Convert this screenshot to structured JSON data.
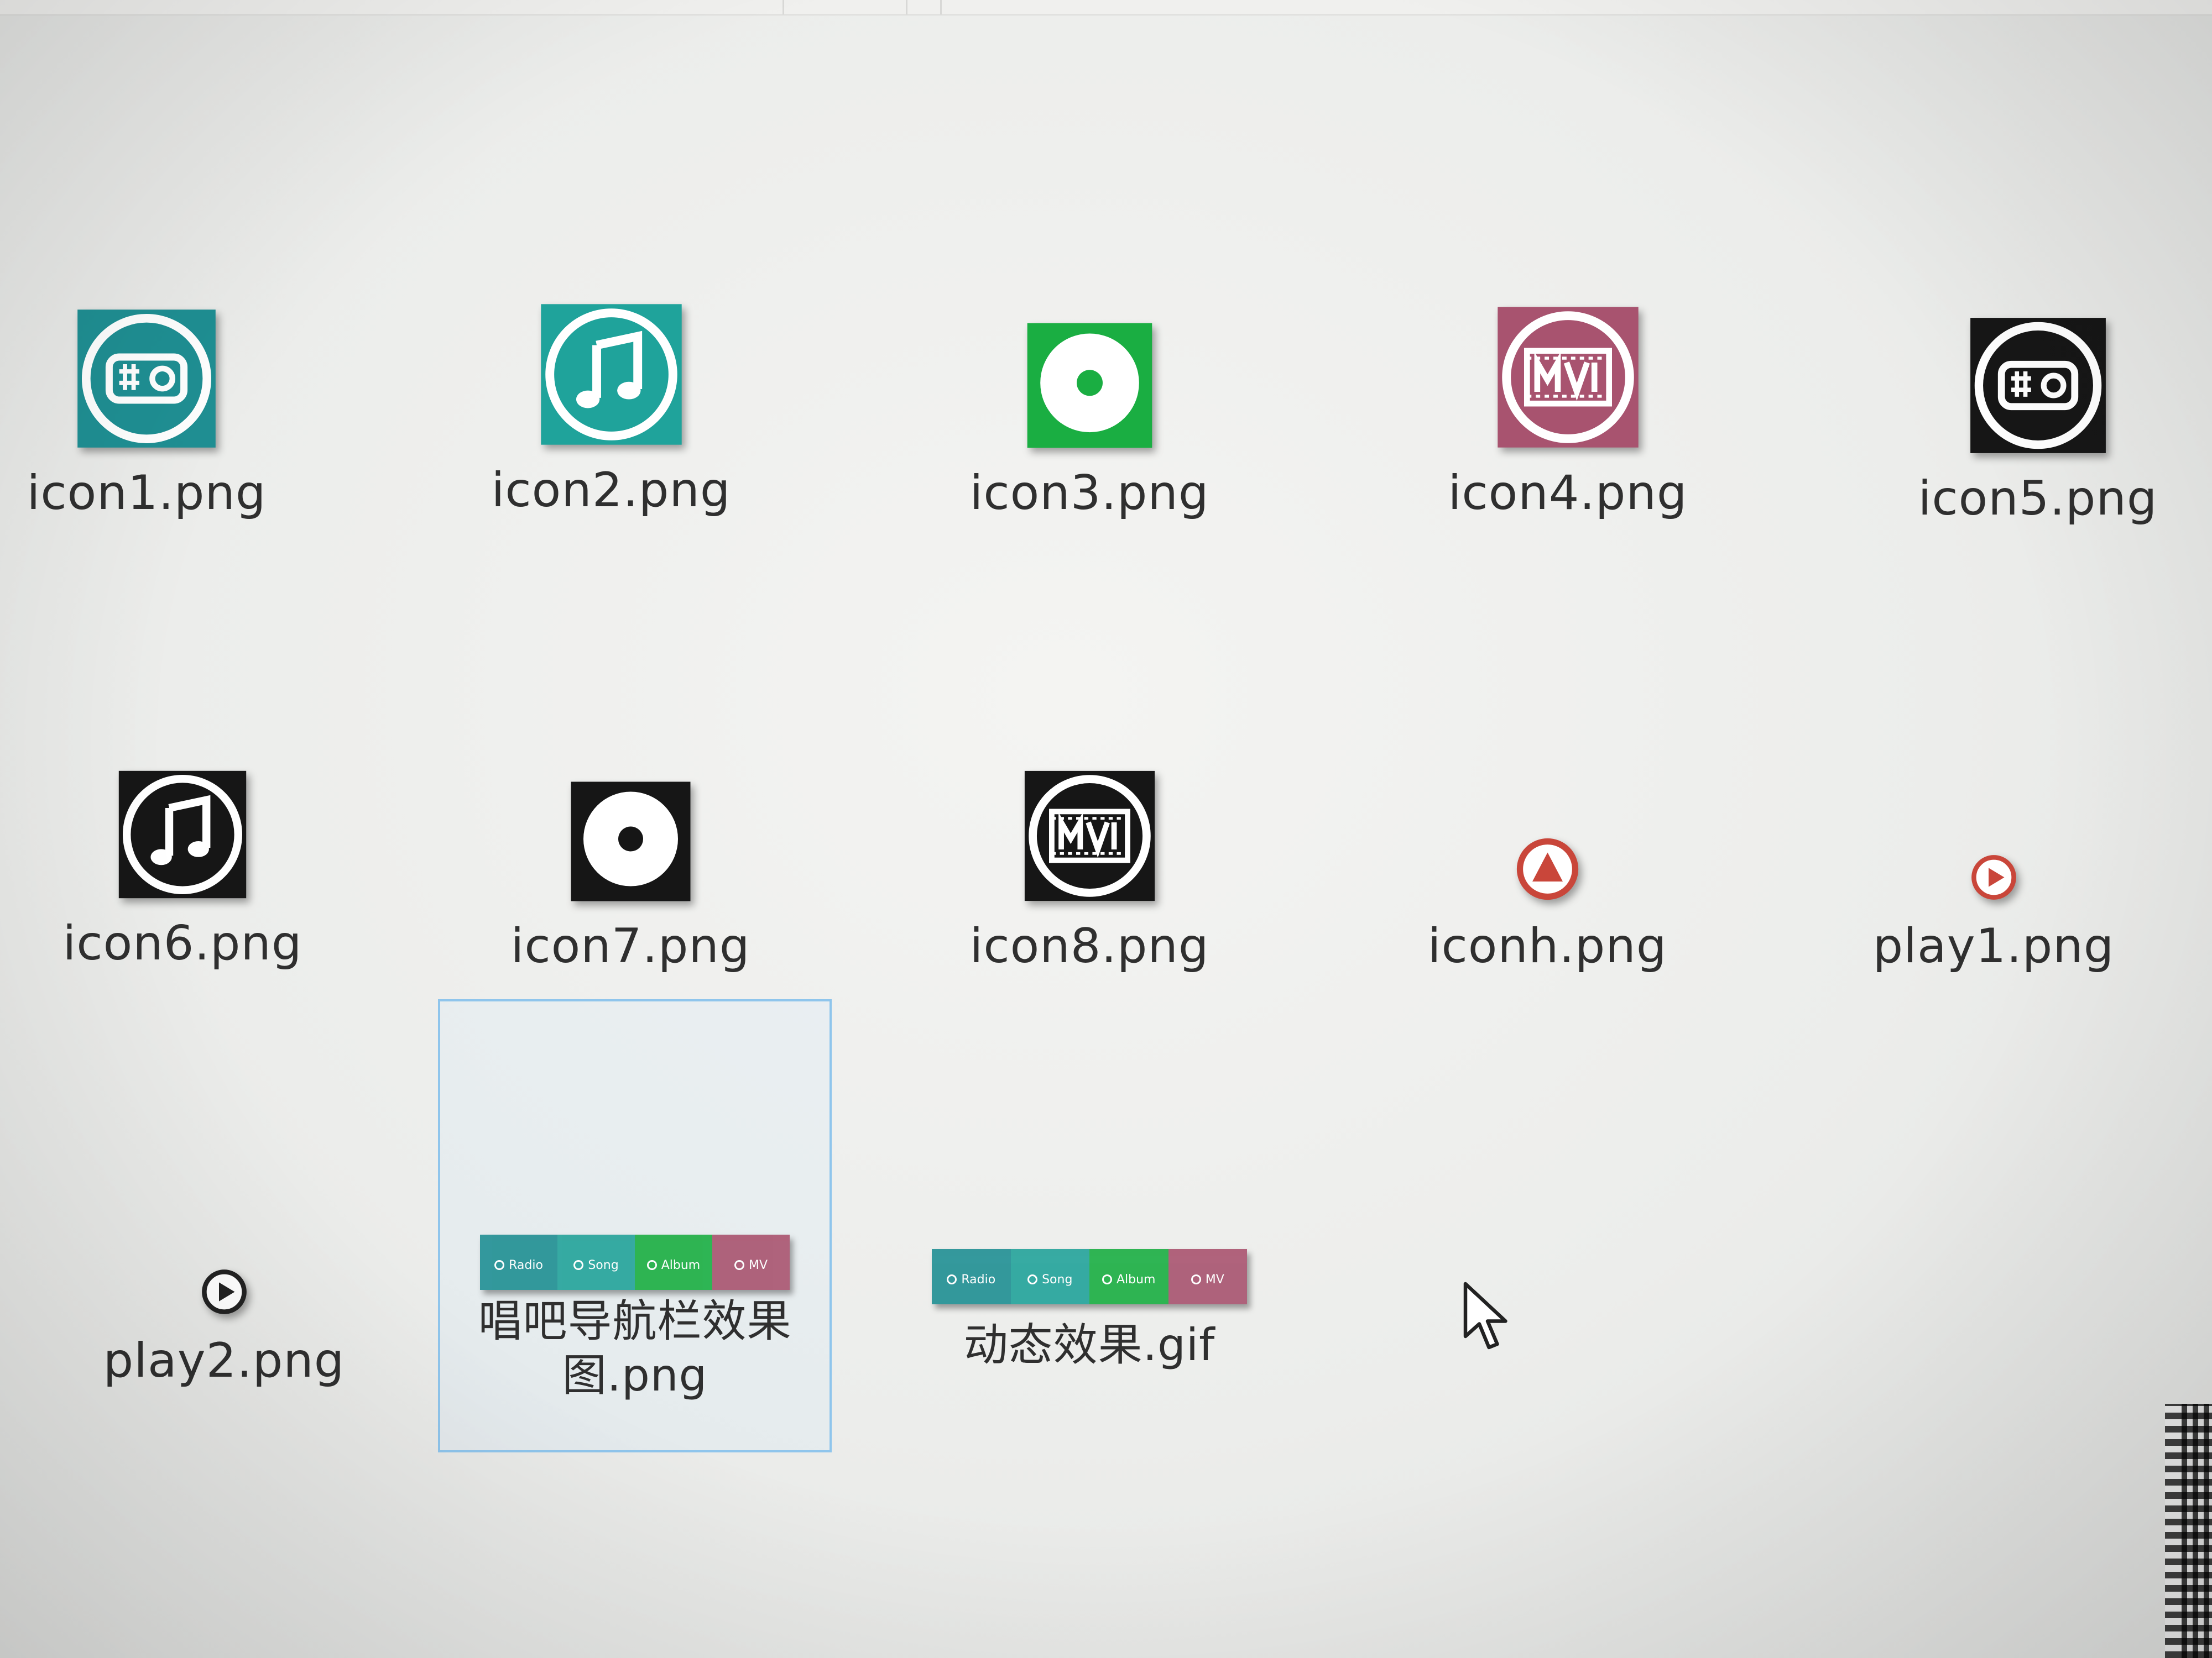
{
  "files": [
    {
      "name": "icon1.png",
      "icon": "radio-icon",
      "color": "#1f8f93"
    },
    {
      "name": "icon2.png",
      "icon": "music-note-icon",
      "color": "#1fa39b"
    },
    {
      "name": "icon3.png",
      "icon": "album-disc-icon",
      "color": "#1aae42"
    },
    {
      "name": "icon4.png",
      "icon": "mv-film-icon",
      "color": "#a8536f"
    },
    {
      "name": "icon5.png",
      "icon": "radio-icon",
      "color": "#161616"
    },
    {
      "name": "icon6.png",
      "icon": "music-note-icon",
      "color": "#161616"
    },
    {
      "name": "icon7.png",
      "icon": "album-disc-icon",
      "color": "#161616"
    },
    {
      "name": "icon8.png",
      "icon": "mv-film-icon",
      "color": "#161616"
    },
    {
      "name": "iconh.png",
      "icon": "triangle-circle-icon",
      "color": "#c9463a"
    },
    {
      "name": "play1.png",
      "icon": "play-circle-icon",
      "color": "#c9463a"
    },
    {
      "name": "play2.png",
      "icon": "play-circle-icon",
      "color": "#222222"
    },
    {
      "name": "唱吧导航栏效果图.png",
      "icon": "navbar-preview-thumbnail",
      "selected": true
    },
    {
      "name": "动态效果.gif",
      "icon": "navbar-preview-thumbnail"
    }
  ],
  "navbar_preview": {
    "segments": [
      {
        "label": "Radio",
        "color": "#1f8f93"
      },
      {
        "label": "Song",
        "color": "#22a39a"
      },
      {
        "label": "Album",
        "color": "#1aae42"
      },
      {
        "label": "MV",
        "color": "#a8536f"
      }
    ]
  },
  "colors": {
    "selection_border": "#8fc5ec",
    "background": "#ecedeb"
  }
}
